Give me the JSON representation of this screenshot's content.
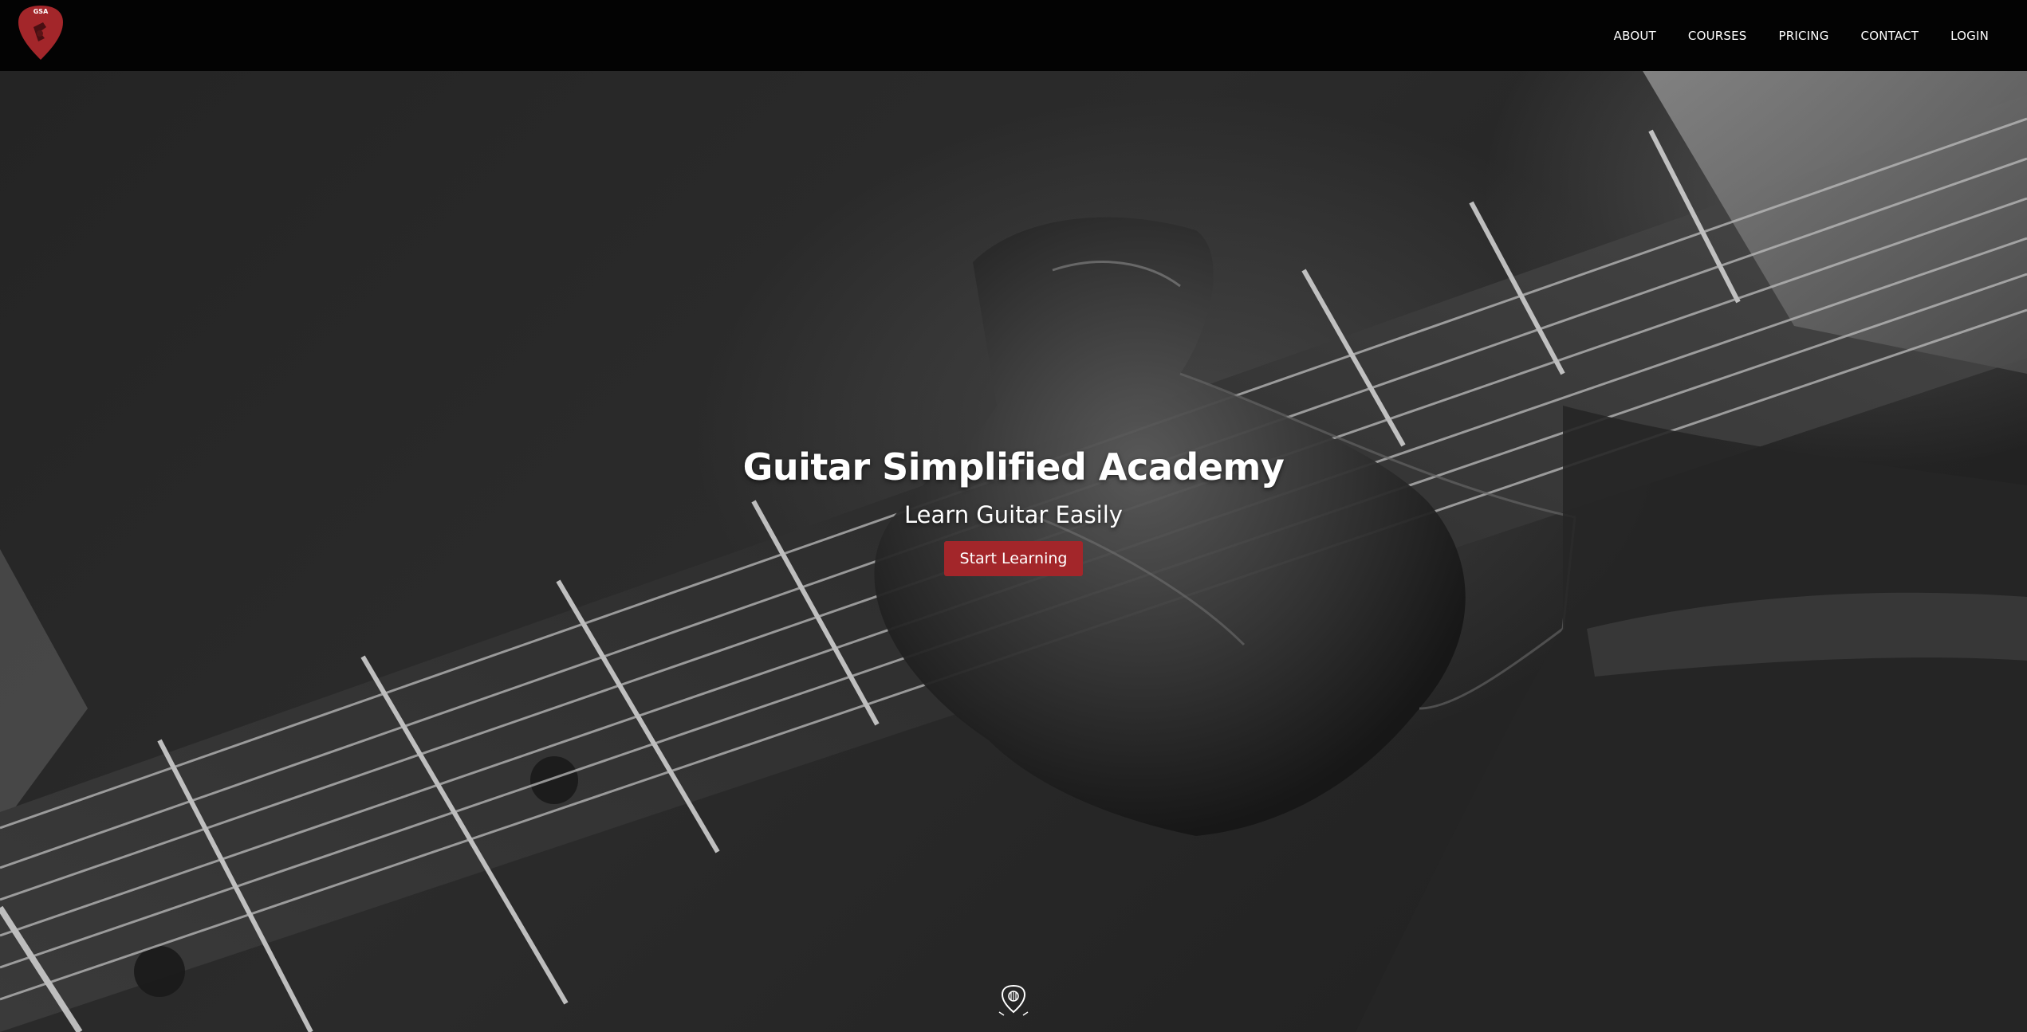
{
  "brand": {
    "logo_text": "GSA",
    "logo_color": "#a3262a"
  },
  "nav": {
    "items": [
      {
        "label": "ABOUT"
      },
      {
        "label": "COURSES"
      },
      {
        "label": "PRICING"
      },
      {
        "label": "CONTACT"
      },
      {
        "label": "LOGIN"
      }
    ]
  },
  "hero": {
    "title": "Guitar Simplified Academy",
    "subtitle": "Learn Guitar Easily",
    "cta_label": "Start Learning",
    "cta_color": "#a3262a",
    "background_image": "guitar-fretboard-photo",
    "scroll_icon": "guitar-pick-badge-icon"
  }
}
